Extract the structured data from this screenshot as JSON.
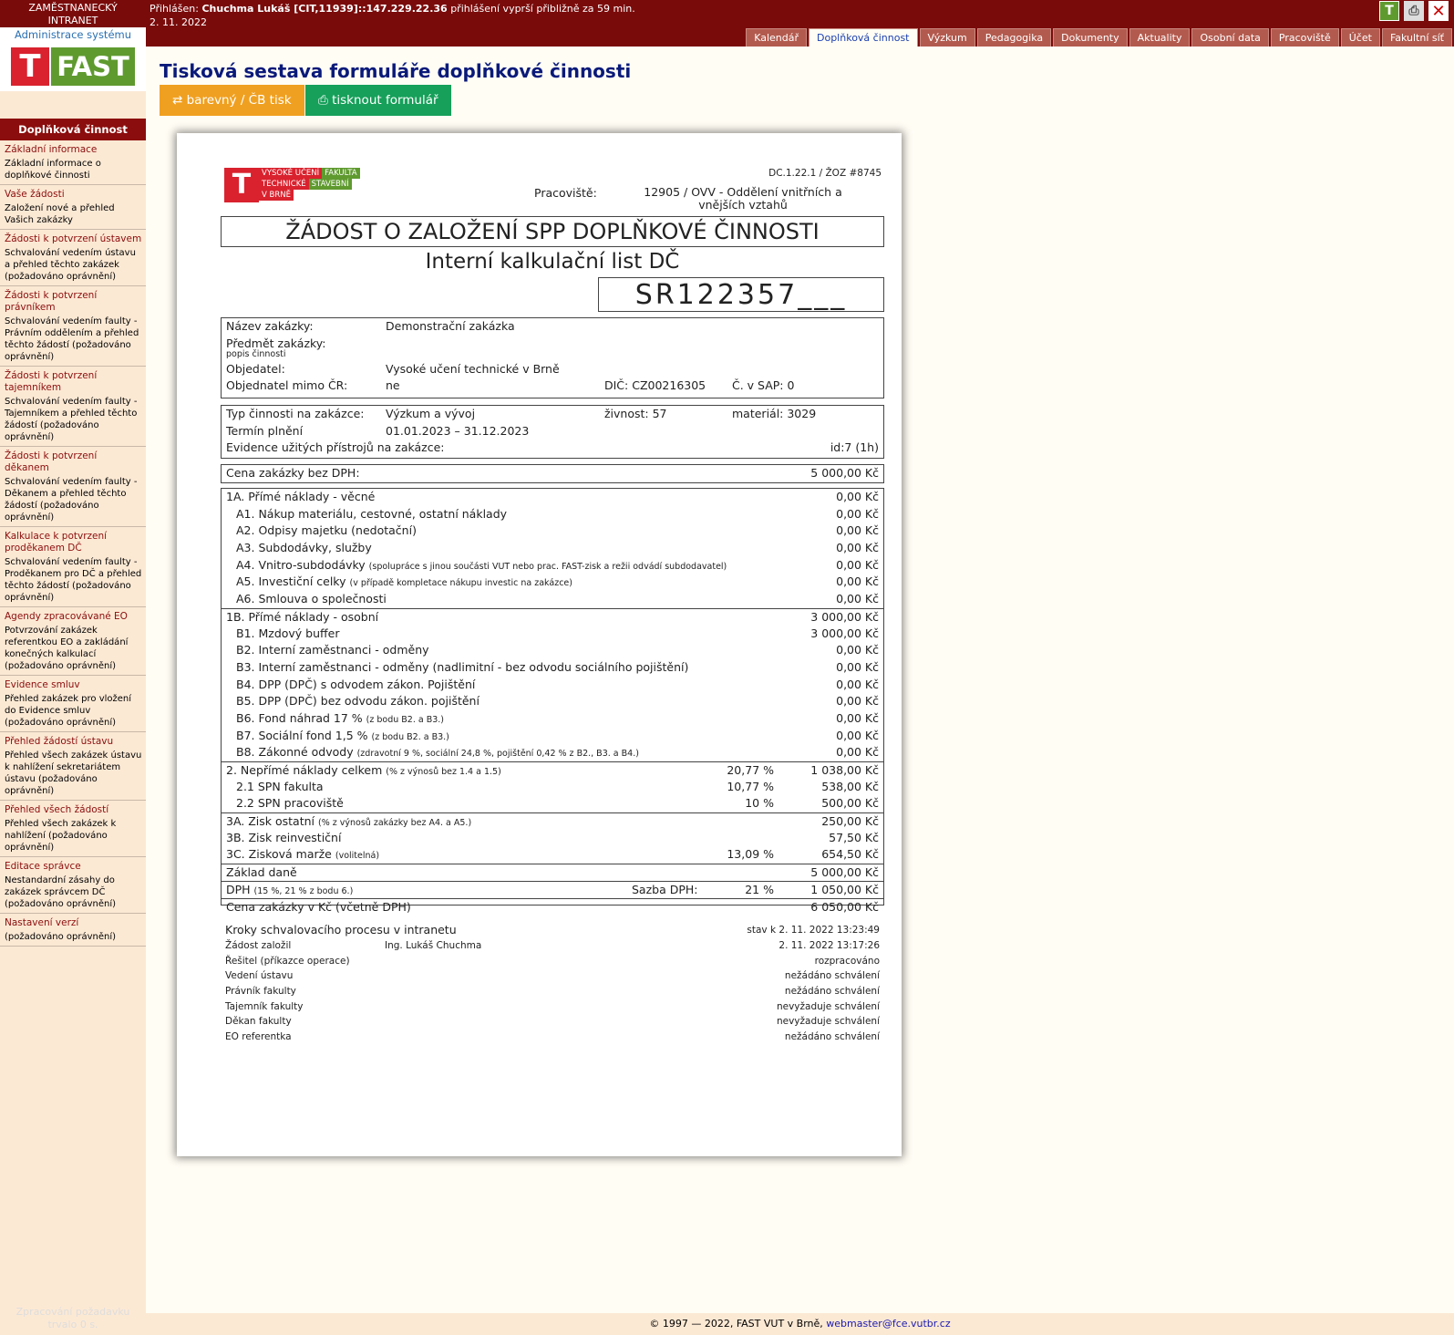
{
  "header": {
    "brand_line1": "ZAMĚSTNANECKÝ",
    "brand_line2": "INTRANET",
    "login_prefix": "Přihlášen:",
    "user": "Chuchma Lukáš [CIT,11939]::147.229.22.36",
    "session": "přihlášení vyprší přibližně za 59 min.",
    "date": "2. 11. 2022"
  },
  "tabs": [
    {
      "label": "Kalendář"
    },
    {
      "label": "Doplňková činnost"
    },
    {
      "label": "Výzkum"
    },
    {
      "label": "Pedagogika"
    },
    {
      "label": "Dokumenty"
    },
    {
      "label": "Aktuality"
    },
    {
      "label": "Osobní data"
    },
    {
      "label": "Pracoviště"
    },
    {
      "label": "Účet"
    },
    {
      "label": "Fakultní síť"
    }
  ],
  "sidebar": {
    "subtitle": "Administrace systému",
    "logo_t": "T",
    "logo_fast": "FAST",
    "heading": "Doplňková činnost",
    "footer": "Zpracování požadavku trvalo 0 s.",
    "items": [
      {
        "title": "Základní informace",
        "desc": "Základní informace o doplňkové činnosti"
      },
      {
        "title": "Vaše žádosti",
        "desc": "Založení nové a přehled Vašich zakázky"
      },
      {
        "title": "Žádosti k potvrzení ústavem",
        "desc": "Schvalování vedením ústavu a přehled těchto zakázek (požadováno oprávnění)"
      },
      {
        "title": "Žádosti k potvrzení právníkem",
        "desc": "Schvalování vedením faulty - Právním oddělením a přehled těchto žádostí (požadováno oprávnění)"
      },
      {
        "title": "Žádosti k potvrzení tajemníkem",
        "desc": "Schvalování vedením faulty - Tajemníkem a přehled těchto žádostí (požadováno oprávnění)"
      },
      {
        "title": "Žádosti k potvrzení děkanem",
        "desc": "Schvalování vedením faulty - Děkanem a přehled těchto žádostí (požadováno oprávnění)"
      },
      {
        "title": "Kalkulace k potvrzení proděkanem DČ",
        "desc": "Schvalování vedením faulty - Proděkanem pro DČ a přehled těchto žádostí (požadováno oprávnění)"
      },
      {
        "title": "Agendy zpracovávané EO",
        "desc": "Potvrzování zakázek referentkou EO a zakládání konečných kalkulací (požadováno oprávnění)"
      },
      {
        "title": "Evidence smluv",
        "desc": "Přehled zakázek pro vložení do Evidence smluv (požadováno oprávnění)"
      },
      {
        "title": "Přehled žádostí ústavu",
        "desc": "Přehled všech zakázek ústavu k nahlížení sekretariátem ústavu (požadováno oprávnění)"
      },
      {
        "title": "Přehled všech žádostí",
        "desc": "Přehled všech zakázek k nahlížení (požadováno oprávnění)"
      },
      {
        "title": "Editace správce",
        "desc": "Nestandardní zásahy do zakázek správcem DČ (požadováno oprávnění)"
      },
      {
        "title": "Nastavení verzí",
        "desc": "(požadováno oprávnění)"
      }
    ]
  },
  "page": {
    "title": "Tisková sestava formuláře doplňkové činnosti",
    "btn_color": "barevný / ČB tisk",
    "btn_print": "tisknout formulář"
  },
  "doc": {
    "logo": {
      "t": "T",
      "l1a": "VYSOKÉ UČENÍ",
      "l1b": "FAKULTA",
      "l2a": "TECHNICKÉ",
      "l2b": "STAVEBNÍ",
      "l3a": "V BRNĚ"
    },
    "ref": "DC.1.22.1 / ŽOZ #8745",
    "prac_label": "Pracoviště:",
    "prac_value": "12905 / OVV - Oddělení vnitřních a vnějších vztahů",
    "title": "ŽÁDOST O ZALOŽENÍ SPP DOPLŇKOVÉ ČINNOSTI",
    "subtitle": "Interní kalkulační list DČ",
    "sr": "SR122357___",
    "info": {
      "nazev_l": "Název zakázky:",
      "nazev_v": "Demonstrační zakázka",
      "predmet_l": "Předmět zakázky:",
      "popis_l": "popis činnosti",
      "obj_l": "Objedatel:",
      "obj_v": "Vysoké učení technické v Brně",
      "mimo_l": "Objednatel mimo ČR:",
      "mimo_v": "ne",
      "dic": "DIČ: CZ00216305",
      "sap": "Č. v SAP: 0"
    },
    "typ": {
      "typ_l": "Typ činnosti na zakázce:",
      "typ_v": "Výzkum a vývoj",
      "zivnost": "živnost: 57",
      "material": "materiál: 3029",
      "termin_l": "Termín plnění",
      "termin_v": "01.01.2023 – 31.12.2023",
      "evid_l": "Evidence užitých přístrojů na zakázce:",
      "evid_v": "id:7 (1h)"
    },
    "cena": {
      "label": "Cena zakázky bez DPH:",
      "value": "5 000,00 Kč"
    },
    "costs": [
      {
        "label": "1A. Přímé náklady - věcné",
        "note": "",
        "pct": "",
        "value": "0,00 Kč",
        "ind": false,
        "sep": false
      },
      {
        "label": "A1. Nákup materiálu, cestovné, ostatní náklady",
        "note": "",
        "pct": "",
        "value": "0,00 Kč",
        "ind": true,
        "sep": false
      },
      {
        "label": "A2. Odpisy majetku (nedotační)",
        "note": "",
        "pct": "",
        "value": "0,00 Kč",
        "ind": true,
        "sep": false
      },
      {
        "label": "A3. Subdodávky, služby",
        "note": "",
        "pct": "",
        "value": "0,00 Kč",
        "ind": true,
        "sep": false
      },
      {
        "label": "A4. Vnitro-subdodávky",
        "note": "(spolupráce s jinou součásti VUT nebo prac. FAST-zisk a režii odvádí subdodavatel)",
        "pct": "",
        "value": "0,00 Kč",
        "ind": true,
        "sep": false
      },
      {
        "label": "A5. Investiční celky",
        "note": "(v případě kompletace nákupu investic na zakázce)",
        "pct": "",
        "value": "0,00 Kč",
        "ind": true,
        "sep": false
      },
      {
        "label": "A6. Smlouva o společnosti",
        "note": "",
        "pct": "",
        "value": "0,00 Kč",
        "ind": true,
        "sep": false
      },
      {
        "label": "1B. Přímé náklady - osobní",
        "note": "",
        "pct": "",
        "value": "3 000,00 Kč",
        "ind": false,
        "sep": true
      },
      {
        "label": "B1. Mzdový buffer",
        "note": "",
        "pct": "",
        "value": "3 000,00 Kč",
        "ind": true,
        "sep": false
      },
      {
        "label": "B2. Interní zaměstnanci - odměny",
        "note": "",
        "pct": "",
        "value": "0,00 Kč",
        "ind": true,
        "sep": false
      },
      {
        "label": "B3. Interní zaměstnanci - odměny (nadlimitní - bez odvodu sociálního pojištění)",
        "note": "",
        "pct": "",
        "value": "0,00 Kč",
        "ind": true,
        "sep": false
      },
      {
        "label": "B4. DPP (DPČ) s odvodem zákon. Pojištění",
        "note": "",
        "pct": "",
        "value": "0,00 Kč",
        "ind": true,
        "sep": false
      },
      {
        "label": "B5. DPP (DPČ) bez odvodu zákon. pojištění",
        "note": "",
        "pct": "",
        "value": "0,00 Kč",
        "ind": true,
        "sep": false
      },
      {
        "label": "B6. Fond náhrad 17 %",
        "note": "(z bodu B2. a B3.)",
        "pct": "",
        "value": "0,00 Kč",
        "ind": true,
        "sep": false
      },
      {
        "label": "B7. Sociální fond 1,5 %",
        "note": "(z bodu B2. a B3.)",
        "pct": "",
        "value": "0,00 Kč",
        "ind": true,
        "sep": false
      },
      {
        "label": "B8. Zákonné odvody",
        "note": "(zdravotní 9 %, sociální 24,8 %, pojištění 0,42 % z B2., B3. a B4.)",
        "pct": "",
        "value": "0,00 Kč",
        "ind": true,
        "sep": false
      },
      {
        "label": "2. Nepřímé náklady celkem",
        "note": "(% z výnosů bez 1.4 a 1.5)",
        "pct": "20,77 %",
        "value": "1 038,00 Kč",
        "ind": false,
        "sep": true
      },
      {
        "label": "2.1 SPN fakulta",
        "note": "",
        "pct": "10,77 %",
        "value": "538,00 Kč",
        "ind": true,
        "sep": false
      },
      {
        "label": "2.2 SPN pracoviště",
        "note": "",
        "pct": "10 %",
        "value": "500,00 Kč",
        "ind": true,
        "sep": false
      },
      {
        "label": "3A. Zisk ostatní",
        "note": "(% z výnosů zakázky bez A4. a A5.)",
        "pct": "",
        "value": "250,00 Kč",
        "ind": false,
        "sep": true
      },
      {
        "label": "3B. Zisk reinvestiční",
        "note": "",
        "pct": "",
        "value": "57,50 Kč",
        "ind": false,
        "sep": false
      },
      {
        "label": "3C. Zisková marže",
        "note": "(volitelná)",
        "pct": "13,09 %",
        "value": "654,50 Kč",
        "ind": false,
        "sep": false
      },
      {
        "label": "Základ daně",
        "note": "",
        "pct": "",
        "value": "5 000,00 Kč",
        "ind": false,
        "sep": true
      }
    ],
    "dph": {
      "label": "DPH",
      "note": "(15 %, 21 % z bodu 6.)",
      "sazba_l": "Sazba DPH:",
      "sazba_v": "21 %",
      "value": "1 050,00 Kč"
    },
    "total": {
      "label": "Cena zakázky v Kč (včetně DPH)",
      "value": "6 050,00 Kč"
    },
    "steps": {
      "title": "Kroky schvalovacího procesu v intranetu",
      "stav": "stav k 2. 11. 2022 13:23:49",
      "rows": [
        {
          "l": "Žádost založil",
          "m": "Ing. Lukáš Chuchma",
          "r": "2. 11. 2022 13:17:26"
        },
        {
          "l": "Řešitel (příkazce operace)",
          "m": "",
          "r": "rozpracováno"
        },
        {
          "l": "Vedení ústavu",
          "m": "",
          "r": "nežádáno schválení"
        },
        {
          "l": "Právník fakulty",
          "m": "",
          "r": "nežádáno schválení"
        },
        {
          "l": "Tajemník fakulty",
          "m": "",
          "r": "nevyžaduje schválení"
        },
        {
          "l": "Děkan fakulty",
          "m": "",
          "r": "nevyžaduje schválení"
        },
        {
          "l": "EO referentka",
          "m": "",
          "r": "nežádáno schválení"
        }
      ]
    }
  },
  "footer": {
    "copy": "© 1997 — 2022, FAST VUT v Brně,",
    "email": "webmaster@fce.vutbr.cz"
  }
}
